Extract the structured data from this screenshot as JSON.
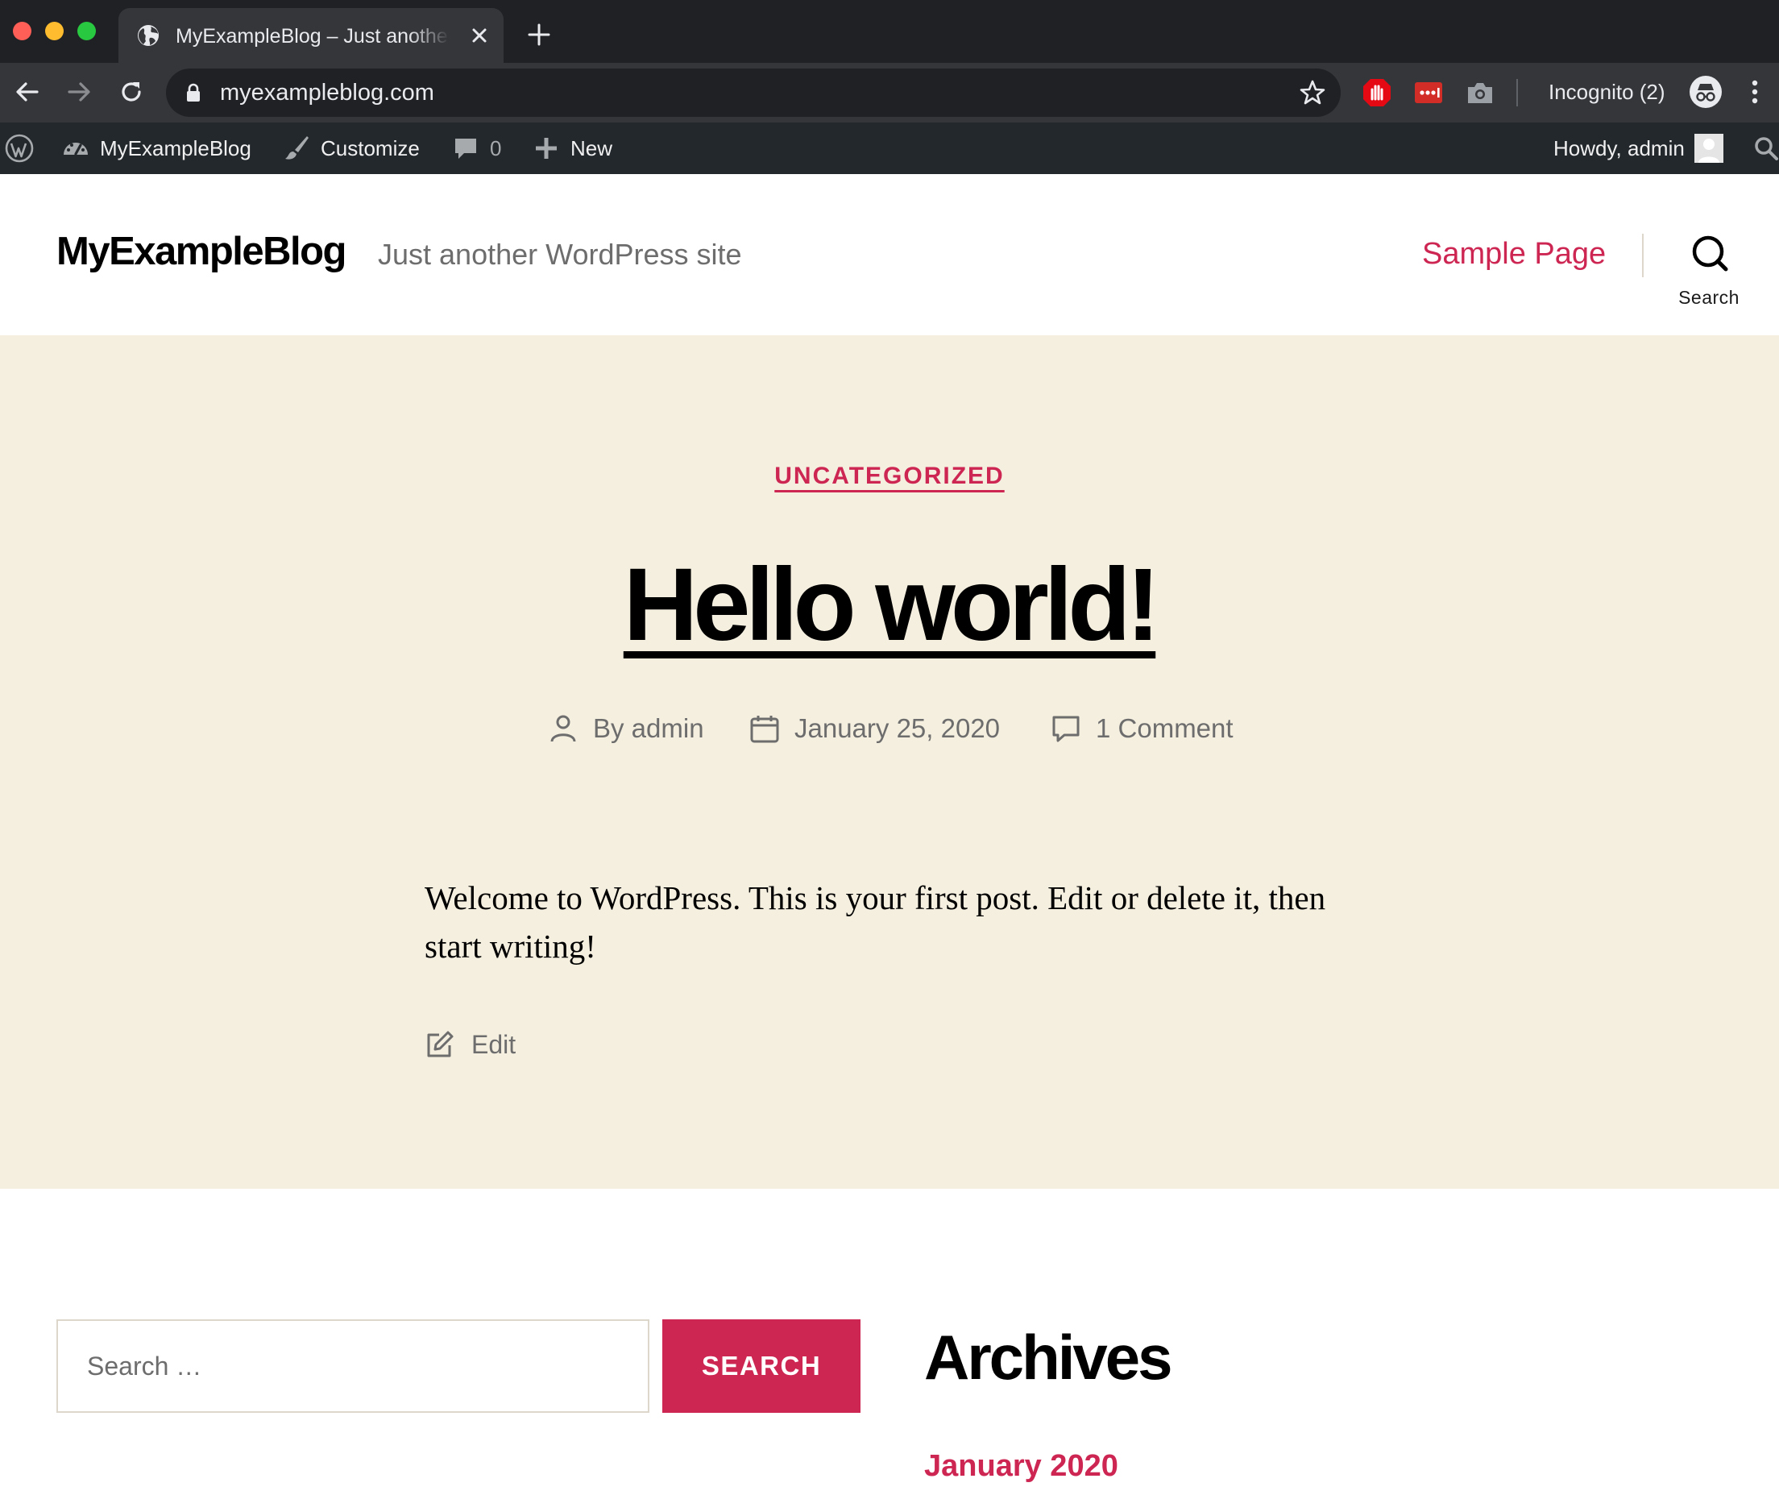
{
  "browser": {
    "tab_title": "MyExampleBlog – Just another WordPress site",
    "url": "myexampleblog.com",
    "incognito_label": "Incognito (2)"
  },
  "admin_bar": {
    "site_name": "MyExampleBlog",
    "customize": "Customize",
    "comments_count": "0",
    "new_label": "New",
    "howdy": "Howdy, admin"
  },
  "site": {
    "title": "MyExampleBlog",
    "description": "Just another WordPress site",
    "nav_items": [
      {
        "label": "Sample Page"
      }
    ],
    "search_label": "Search"
  },
  "post": {
    "category": "UNCATEGORIZED",
    "title": "Hello world!",
    "author": "By admin",
    "date": "January 25, 2020",
    "comments": "1 Comment",
    "body": "Welcome to WordPress. This is your first post. Edit or delete it, then start writing!",
    "edit_label": "Edit"
  },
  "widgets": {
    "search_placeholder": "Search …",
    "search_button": "SEARCH",
    "archives_title": "Archives",
    "archive_items": [
      {
        "label": "January 2020"
      }
    ]
  },
  "colors": {
    "accent": "#cd2653",
    "post_background": "#f5efe0",
    "admin_bar": "#23282d",
    "chrome_tabbar": "#202124",
    "chrome_toolbar": "#35363a"
  },
  "icons": {
    "tab_favicon": "globe-icon",
    "header_search": "search-icon",
    "meta_author": "user-icon",
    "meta_date": "calendar-icon",
    "meta_comments": "comment-icon",
    "edit": "edit-icon"
  }
}
